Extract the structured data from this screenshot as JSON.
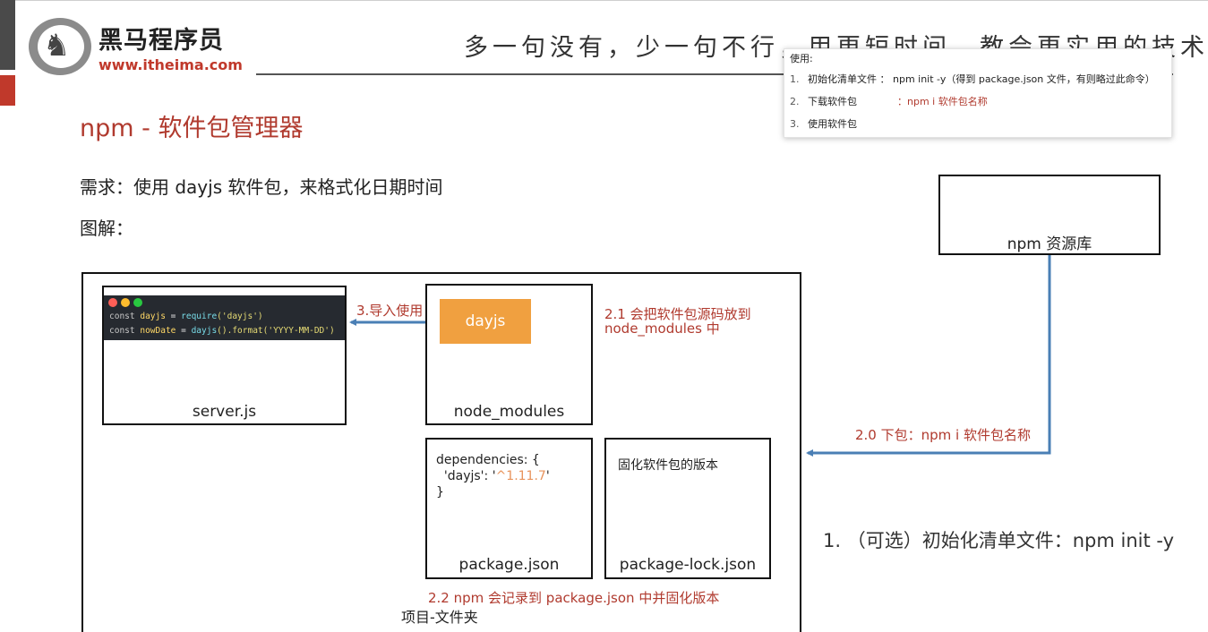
{
  "header": {
    "brand_cn": "黑马程序员",
    "brand_url": "www.itheima.com",
    "slogan": "多一句没有，少一句不行，用更短时间，教会更实用的技术！"
  },
  "page_title": "npm - 软件包管理器",
  "requirement": "需求：使用 dayjs 软件包，来格式化日期时间",
  "diagram_label": "图解：",
  "tip": {
    "title": "使用:",
    "items": [
      {
        "num": "1.",
        "text": "初始化清单文件 ： npm init -y（得到 package.json 文件，有则略过此命令）"
      },
      {
        "num": "2.",
        "label": "下载软件包",
        "sep": "：",
        "cmd": "npm i 软件包名称"
      },
      {
        "num": "3.",
        "text": "使用软件包"
      }
    ]
  },
  "diagram": {
    "server_label": "server.js",
    "code_lines": [
      {
        "kw": "const",
        "var": "dayjs",
        "op": " = ",
        "fn": "require",
        "arg": "('dayjs')"
      },
      {
        "kw": "const",
        "var": "nowDate",
        "op": " = ",
        "fn": "dayjs",
        "arg": "().format('YYYY-MM-DD')"
      }
    ],
    "modules_label": "node_modules",
    "dayjs_block": "dayjs",
    "package_label": "package.json",
    "package_code_open": "dependencies: {",
    "package_code_key": "  'dayjs': '",
    "package_code_version": "^1.11.7",
    "package_code_quote": "'",
    "package_code_close": "}",
    "lock_label": "package-lock.json",
    "lock_text": "固化软件包的版本",
    "registry_label": "npm 资源库",
    "anno_import": "3.导入使用",
    "anno_copy_line1": "2.1 会把软件包源码放到",
    "anno_copy_line2": "node_modules 中",
    "anno_download": "2.0 下包：npm i 软件包名称",
    "anno_record": "2.2 npm 会记录到 package.json 中并固化版本",
    "project_label": "项目-文件夹",
    "optional_step": "1. （可选）初始化清单文件：npm init -y"
  },
  "colors": {
    "accent_red": "#b03a2e",
    "arrow_blue": "#4a7fb5",
    "dayjs_orange": "#f0a040",
    "code_bg": "#262a30"
  }
}
